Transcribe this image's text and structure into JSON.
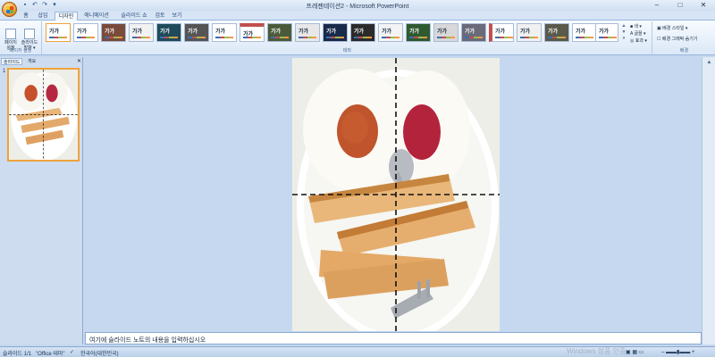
{
  "window": {
    "title": "프레젠테이션2 - Microsoft PowerPoint",
    "minimize": "–",
    "maximize": "□",
    "close": "✕"
  },
  "qat": {
    "save": "▪",
    "undo": "↶",
    "redo": "↷",
    "more": "▾"
  },
  "tabs": [
    "홈",
    "삽입",
    "디자인",
    "애니메이션",
    "슬라이드 쇼",
    "검토",
    "보기"
  ],
  "active_tab": "디자인",
  "ribbon": {
    "page_setup": {
      "btn1": "페이지\n설정",
      "btn2": "슬라이드\n방향 ▾",
      "group_label": "페이지 설정"
    },
    "themes": {
      "group_label": "테마",
      "items": [
        "가가",
        "가가",
        "가가",
        "가가",
        "가가",
        "가가",
        "가가",
        "가가",
        "가가",
        "가가",
        "가가",
        "가가",
        "가가",
        "가가",
        "가가",
        "가가",
        "가가",
        "가가",
        "가가",
        "가가",
        "가가"
      ]
    },
    "theme_options": {
      "colors": "색 ▾",
      "fonts": "글꼴 ▾",
      "effects": "효과 ▾"
    },
    "background": {
      "styles": "배경 스타일 ▾",
      "hide_graphics": "배경 그래픽 숨기기",
      "group_label": "배경"
    }
  },
  "slides_pane": {
    "tab_slides": "슬라이드",
    "tab_outline": "개요",
    "slide_number": "1"
  },
  "notes": {
    "placeholder": "여기에 슬라이드 노트의 내용을 입력하십시오"
  },
  "status": {
    "slide": "슬라이드 1/1",
    "theme": "\"Office 테마\"",
    "language": "한국어(대한민국)"
  },
  "watermark": "Windows 정품 인증"
}
